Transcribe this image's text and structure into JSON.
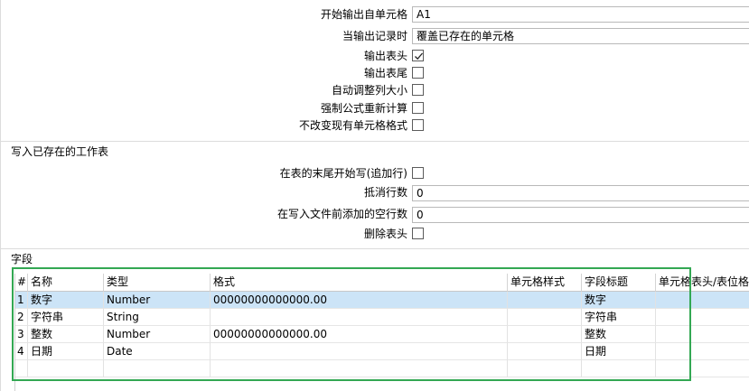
{
  "output_settings": {
    "start_cell_label": "开始输出自单元格",
    "start_cell_value": "A1",
    "when_output_label": "当输出记录时",
    "when_output_value": "覆盖已存在的单元格",
    "output_header_label": "输出表头",
    "output_header_checked": true,
    "output_footer_label": "输出表尾",
    "output_footer_checked": false,
    "auto_size_label": "自动调整列大小",
    "auto_size_checked": false,
    "force_recalc_label": "强制公式重新计算",
    "force_recalc_checked": false,
    "keep_format_label": "不改变现有单元格格式",
    "keep_format_checked": false
  },
  "write_existing": {
    "section_title": "写入已存在的工作表",
    "append_label": "在表的末尾开始写(追加行)",
    "append_checked": false,
    "offset_rows_label": "抵消行数",
    "offset_rows_value": "0",
    "empty_rows_label": "在写入文件前添加的空行数",
    "empty_rows_value": "0",
    "omit_header_label": "删除表头",
    "omit_header_checked": false
  },
  "fields": {
    "section_title": "字段",
    "columns": [
      "#",
      "名称",
      "类型",
      "格式",
      "单元格样式",
      "字段标题",
      "单元格表头/表位格式"
    ],
    "rows": [
      [
        "1",
        "数字",
        "Number",
        "00000000000000.00",
        "",
        "数字",
        ""
      ],
      [
        "2",
        "字符串",
        "String",
        "",
        "",
        "字符串",
        ""
      ],
      [
        "3",
        "整数",
        "Number",
        "00000000000000.00",
        "",
        "整数",
        ""
      ],
      [
        "4",
        "日期",
        "Date",
        "",
        "",
        "日期",
        ""
      ]
    ],
    "selected_row": 0
  },
  "colors": {
    "selection": "#cce4f7",
    "highlight_box": "#33a853"
  }
}
